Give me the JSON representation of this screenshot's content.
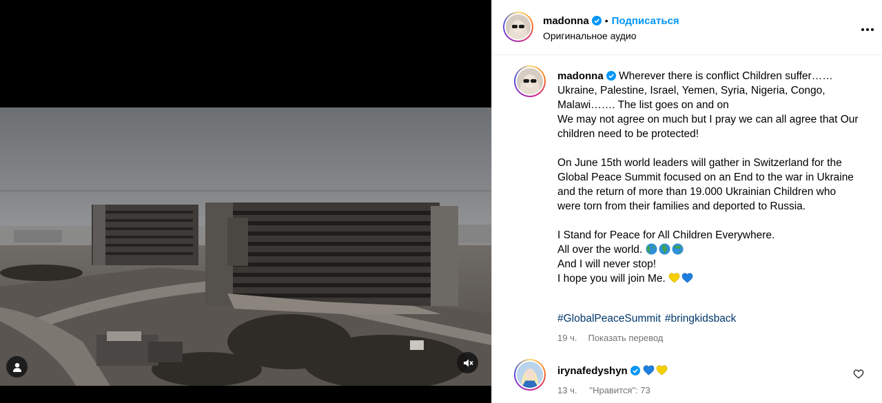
{
  "colors": {
    "link_blue": "#0095f6",
    "hashtag_blue": "#00376b",
    "muted_text": "#737373",
    "verified_badge": "#0095f6",
    "heart_blue": "#1f7fe0",
    "heart_yellow": "#f5d000"
  },
  "media": {
    "kind": "video",
    "description_icons": [
      "user-tag-icon",
      "mute-icon"
    ]
  },
  "header": {
    "username": "madonna",
    "separator": "•",
    "follow_label": "Подписаться",
    "audio_label": "Оригинальное аудио",
    "more_icon": "more-horizontal-icon"
  },
  "caption": {
    "username": "madonna",
    "line1": "Wherever there is conflict Children suffer…… Ukraine, Palestine, Israel, Yemen, Syria, Nigeria, Congo, Malawi……. The list goes on and on",
    "line2": "We may not agree on much but I pray we can all agree that Our children need to be protected!",
    "para2": "On June 15th world leaders will gather in Switzerland for the Global Peace Summit focused on an End to the war in Ukraine and the return of more than 19.000 Ukrainian Children who were torn from their families and deported to Russia.",
    "line3": "I Stand for Peace for All Children Everywhere.",
    "line4": "All over the world.",
    "line4_emojis": [
      "globe-americas-icon",
      "globe-europe-africa-icon",
      "globe-asia-icon"
    ],
    "line5": "And I will never stop!",
    "line6": "I hope you will join Me.",
    "line6_emojis": [
      "yellow-heart-icon",
      "blue-heart-icon"
    ],
    "hashtags": [
      "#GlobalPeaceSummit",
      "#bringkidsback"
    ],
    "time": "19 ч.",
    "translate_label": "Показать перевод"
  },
  "comments": [
    {
      "username": "irynafedyshyn",
      "emojis": [
        "blue-heart-icon",
        "yellow-heart-icon"
      ],
      "time": "13 ч.",
      "likes_label": "\"Нравится\": 73",
      "like_icon": "heart-outline-icon"
    }
  ]
}
